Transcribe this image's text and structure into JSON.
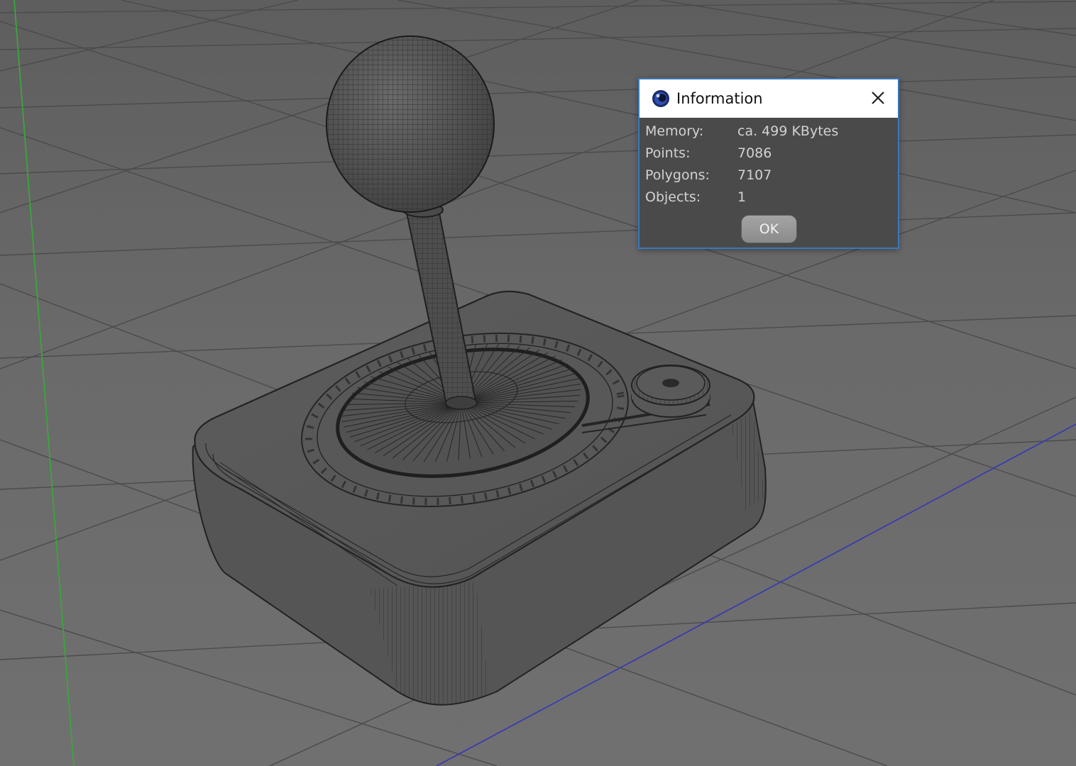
{
  "dialog": {
    "title": "Information",
    "rows": [
      {
        "label": "Memory:",
        "value": "ca. 499 KBytes"
      },
      {
        "label": "Points:",
        "value": "7086"
      },
      {
        "label": "Polygons:",
        "value": "7107"
      },
      {
        "label": "Objects:",
        "value": "1"
      }
    ],
    "ok_label": "OK",
    "icons": {
      "app": "cinema4d-app-icon",
      "close": "close-icon"
    }
  },
  "viewport": {
    "scene_object": "joystick-wireframe-model",
    "colors": {
      "background": "#6a6a6a",
      "grid": "#4c4c4c",
      "model_fill": "#5a5a5a",
      "wire": "#2a2a2a",
      "x_axis": "#3b3bb0",
      "y_axis": "#3ca53c"
    }
  }
}
